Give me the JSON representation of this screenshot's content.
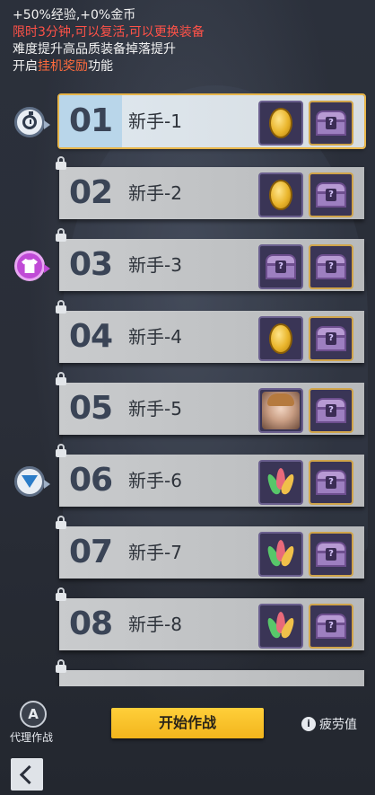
{
  "info": {
    "line1": "+50%经验,+0%金币",
    "line2": "限时3分钟,可以复活,可以更换装备",
    "line3": "难度提升高品质装备掉落提升",
    "line4_pre": "开启",
    "line4_hl": "挂机奖励",
    "line4_post": "功能"
  },
  "stages": [
    {
      "num": "01",
      "name": "新手-1",
      "reward1": "coin-icon",
      "reward2": "chest-icon",
      "locked": false,
      "selected": true
    },
    {
      "num": "02",
      "name": "新手-2",
      "reward1": "coin-icon",
      "reward2": "chest-icon",
      "locked": true
    },
    {
      "num": "03",
      "name": "新手-3",
      "reward1": "chest-icon",
      "reward2": "chest-icon",
      "locked": true
    },
    {
      "num": "04",
      "name": "新手-4",
      "reward1": "coin-icon",
      "reward2": "chest-icon",
      "locked": true
    },
    {
      "num": "05",
      "name": "新手-5",
      "reward1": "character-avatar-icon",
      "reward2": "chest-icon",
      "locked": true
    },
    {
      "num": "06",
      "name": "新手-6",
      "reward1": "leaves-icon",
      "reward2": "chest-icon",
      "locked": true
    },
    {
      "num": "07",
      "name": "新手-7",
      "reward1": "leaves-icon",
      "reward2": "chest-icon",
      "locked": true
    },
    {
      "num": "08",
      "name": "新手-8",
      "reward1": "leaves-icon",
      "reward2": "chest-icon",
      "locked": true
    }
  ],
  "markers": [
    {
      "stage": "01",
      "icon": "stopwatch-icon"
    },
    {
      "stage": "03",
      "icon": "shirt-icon"
    },
    {
      "stage": "06",
      "icon": "shield-icon"
    }
  ],
  "bottom": {
    "auto_letter": "A",
    "auto_label": "代理作战",
    "start_label": "开始作战",
    "fatigue_icon": "i",
    "fatigue_label": "疲劳值"
  },
  "colors": {
    "accent_gold": "#f2b51c",
    "warning_red": "#ff5248",
    "highlight_orange": "#ff6b3d",
    "selected_outline": "#e8b64a",
    "marker_purple": "#c04ad6"
  }
}
